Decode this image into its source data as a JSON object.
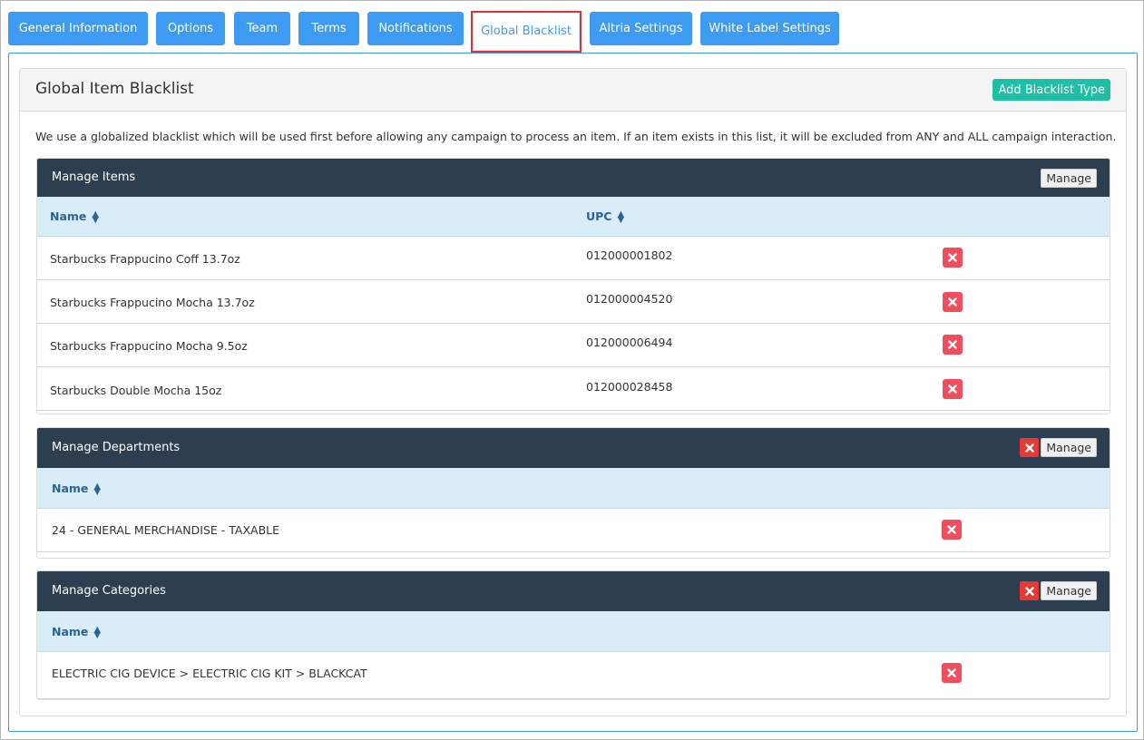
{
  "tabs": [
    {
      "label": "General Information",
      "active": false
    },
    {
      "label": "Options",
      "active": false
    },
    {
      "label": "Team",
      "active": false
    },
    {
      "label": "Terms",
      "active": false
    },
    {
      "label": "Notifications",
      "active": false
    },
    {
      "label": "Global Blacklist",
      "active": true
    },
    {
      "label": "Altria Settings",
      "active": false
    },
    {
      "label": "White Label Settings",
      "active": false
    }
  ],
  "panel": {
    "title": "Global Item Blacklist",
    "add_button": "Add Blacklist Type",
    "description": "We use a globalized blacklist which will be used first before allowing any campaign to process an item. If an item exists in this list, it will be excluded from ANY and ALL campaign interaction."
  },
  "items": {
    "title": "Manage Items",
    "manage_label": "Manage",
    "columns": [
      "Name",
      "UPC"
    ],
    "rows": [
      {
        "name": "Starbucks Frappucino Coff 13.7oz",
        "upc": "012000001802"
      },
      {
        "name": "Starbucks Frappucino Mocha 13.7oz",
        "upc": "012000004520"
      },
      {
        "name": "Starbucks Frappucino Mocha 9.5oz",
        "upc": "012000006494"
      },
      {
        "name": "Starbucks Double Mocha 15oz",
        "upc": "012000028458"
      }
    ]
  },
  "departments": {
    "title": "Manage Departments",
    "manage_label": "Manage",
    "columns": [
      "Name"
    ],
    "rows": [
      {
        "name": "24 - GENERAL MERCHANDISE - TAXABLE"
      }
    ]
  },
  "categories": {
    "title": "Manage Categories",
    "manage_label": "Manage",
    "columns": [
      "Name"
    ],
    "rows": [
      {
        "name": "ELECTRIC CIG DEVICE > ELECTRIC CIG KIT > BLACKCAT"
      }
    ]
  },
  "colors": {
    "tab_blue": "#3d9bf2",
    "header_dark": "#2c3e50",
    "delete_red": "#f04e5e",
    "add_teal": "#1fbfa6",
    "thead_blue": "#d9ecf7"
  },
  "icons": {
    "delete": "close-icon",
    "sort": "sort-icon"
  }
}
